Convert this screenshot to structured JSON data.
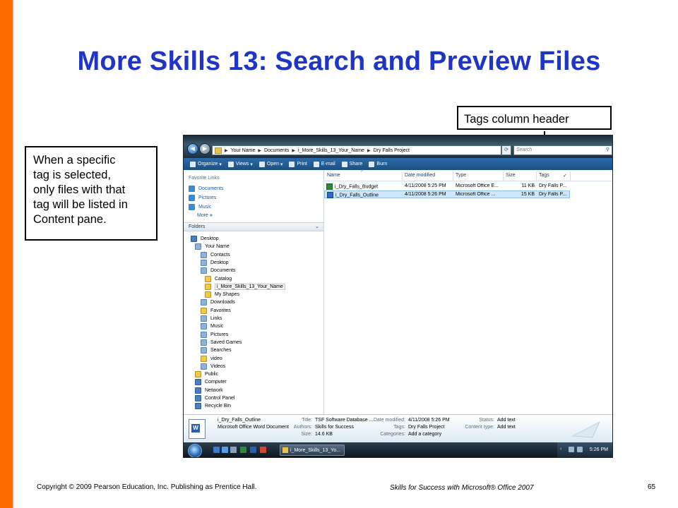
{
  "slide": {
    "title": "More Skills 13: Search and Preview Files",
    "callout_tags": "Tags column header",
    "callout_left": [
      "When a specific",
      "tag is selected,",
      "only files with that",
      "tag will be listed in",
      "Content pane."
    ],
    "footer_copyright": "Copyright © 2009 Pearson Education, Inc. Publishing as Prentice Hall.",
    "footer_book": "Skills for Success with Microsoft® Office 2007",
    "page_number": "65",
    "accent_color": "#ff6a00",
    "title_color": "#1e35c8"
  },
  "explorer": {
    "address": [
      "Your Name",
      "Documents",
      "i_More_Skills_13_Your_Name",
      "Dry Falls Project"
    ],
    "search_placeholder": "Search",
    "toolbar": [
      "Organize",
      "Views",
      "Open",
      "Print",
      "E-mail",
      "Share",
      "Burn"
    ],
    "favorite_links_header": "Favorite Links",
    "favorite_links": [
      "Documents",
      "Pictures",
      "Music"
    ],
    "more_label": "More",
    "folders_header": "Folders",
    "tree": [
      {
        "label": "Desktop",
        "icon": "pc"
      },
      {
        "label": "Your Name",
        "icon": "doc"
      },
      {
        "label": "Contacts",
        "icon": "doc"
      },
      {
        "label": "Desktop",
        "icon": "doc"
      },
      {
        "label": "Documents",
        "icon": "doc"
      },
      {
        "label": "Catalog",
        "icon": "fold"
      },
      {
        "label": "i_More_Skills_13_Your_Name",
        "icon": "fold"
      },
      {
        "label": "My Shapes",
        "icon": "fold"
      },
      {
        "label": "Downloads",
        "icon": "doc"
      },
      {
        "label": "Favorites",
        "icon": "fold"
      },
      {
        "label": "Links",
        "icon": "doc"
      },
      {
        "label": "Music",
        "icon": "doc"
      },
      {
        "label": "Pictures",
        "icon": "doc"
      },
      {
        "label": "Saved Games",
        "icon": "doc"
      },
      {
        "label": "Searches",
        "icon": "doc"
      },
      {
        "label": "video",
        "icon": "fold"
      },
      {
        "label": "Videos",
        "icon": "doc"
      },
      {
        "label": "Public",
        "icon": "fold"
      },
      {
        "label": "Computer",
        "icon": "pc"
      },
      {
        "label": "Network",
        "icon": "pc"
      },
      {
        "label": "Control Panel",
        "icon": "pc"
      },
      {
        "label": "Recycle Bin",
        "icon": "pc"
      }
    ],
    "columns": {
      "name": "Name",
      "date": "Date modified",
      "type": "Type",
      "size": "Size",
      "tags": "Tags",
      "check": "✓"
    },
    "files": [
      {
        "name": "i_Dry_Falls_Budget",
        "date": "4/11/2008 5:25 PM",
        "type": "Microsoft Office E...",
        "size": "11 KB",
        "tags": "Dry Falls P..."
      },
      {
        "name": "i_Dry_Falls_Outline",
        "date": "4/11/2008 5:26 PM",
        "type": "Microsoft Office ...",
        "size": "15 KB",
        "tags": "Dry Falls P..."
      }
    ],
    "details": {
      "file_name": "i_Dry_Falls_Outline",
      "file_type": "Microsoft Office Word Document",
      "title_label": "Title:",
      "title_value": "TSF Software Database ...",
      "authors_label": "Authors:",
      "authors_value": "Skills for Success",
      "size_label": "Size:",
      "size_value": "14.6 KB",
      "date_label": "Date modified:",
      "date_value": "4/11/2008 5:26 PM",
      "tags_label": "Tags:",
      "tags_value": "Dry Falls Project",
      "categories_label": "Categories:",
      "categories_value": "Add a category",
      "status_label": "Status:",
      "status_value": "Add text",
      "content_label": "Content type:",
      "content_value": "Add text"
    },
    "taskbar": {
      "task_label": "i_More_Skills_13_Yo...",
      "clock": "5:26 PM"
    }
  }
}
